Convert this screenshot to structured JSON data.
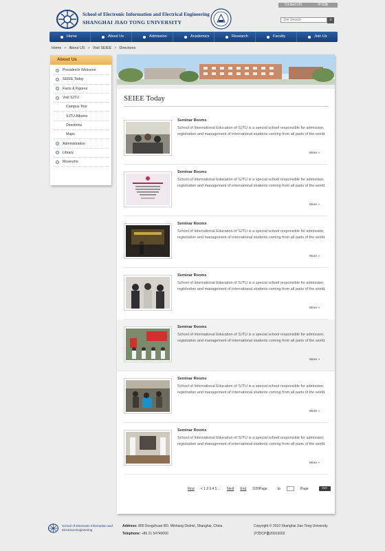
{
  "utility": {
    "contact": "Contact US",
    "chinese": "中文版"
  },
  "header": {
    "school_name": "School of Electronic Information and Electrical Engineering",
    "university_name": "SHANGHAI JIAO TONG UNIVERSITY",
    "search_placeholder": "Site Search"
  },
  "nav": [
    "Home",
    "About Us",
    "Admission",
    "Academics",
    "Research",
    "Faculty",
    "Join Us"
  ],
  "breadcrumb": {
    "home": "Home",
    "about": "About US",
    "visit": "Visit SEIEE",
    "current": "Directions",
    "separator": ">"
  },
  "sidebar": {
    "title": "About Us",
    "items": [
      {
        "label": "President's Welcome",
        "sub": false,
        "icon": "plus"
      },
      {
        "label": "SEIEE Today",
        "sub": false,
        "icon": "plus"
      },
      {
        "label": "Facts & Figures",
        "sub": false,
        "icon": "plus"
      },
      {
        "label": "Visit SJTU",
        "sub": false,
        "icon": "minus"
      },
      {
        "label": "Campus Tour",
        "sub": true,
        "icon": ""
      },
      {
        "label": "SJTU Albums",
        "sub": true,
        "icon": ""
      },
      {
        "label": "Directions",
        "sub": true,
        "icon": ""
      },
      {
        "label": "Maps",
        "sub": true,
        "icon": ""
      },
      {
        "label": "Administration",
        "sub": false,
        "icon": "plus"
      },
      {
        "label": "Library",
        "sub": false,
        "icon": "plus"
      },
      {
        "label": "Museums",
        "sub": false,
        "icon": "plus"
      }
    ]
  },
  "main": {
    "title": "SEIEE Today",
    "news": [
      {
        "title": "Seminar Rooms",
        "desc": "School of International Education of SJTU is a special school responsible for admission, registration and management of international students coming from all parts of the world.",
        "more": "More »"
      },
      {
        "title": "Seminar Rooms",
        "desc": "School of International Education of SJTU is a special school responsible for admission, registration and management of international students coming from all parts of the world.",
        "more": "More »"
      },
      {
        "title": "Seminar Rooms",
        "desc": "School of International Education of SJTU is a special school responsible for admission, registration and management of international students coming from all parts of the world.",
        "more": "More »"
      },
      {
        "title": "Seminar Rooms",
        "desc": "School of International Education of SJTU is a special school responsible for admission, registration and management of international students coming from all parts of the world.",
        "more": "More »"
      },
      {
        "title": "Seminar Rooms",
        "desc": "School of International Education of SJTU is a special school responsible for admission, registration and management of international students coming from all parts of the world.",
        "more": "More »"
      },
      {
        "title": "Seminar Rooms",
        "desc": "School of International Education of SJTU is a special school responsible for admission, registration and management of international students coming from all parts of the world.",
        "more": "More »"
      },
      {
        "title": "Seminar Rooms",
        "desc": "School of International Education of SJTU is a special school responsible for admission, registration and management of international students coming from all parts of the world.",
        "more": "More »"
      }
    ]
  },
  "pager": {
    "first": "First",
    "pages": "< 1 2 3 4 5 ...",
    "next": "Next",
    "end": "End",
    "info": "2/20Page",
    "to": "to",
    "page": "Page",
    "go": "GO"
  },
  "footer": {
    "name": "School of Electronic Information and Electrical Engineering",
    "address_label": "Address:",
    "address": "800 Dongchuan RD. Minhang District, Shanghai, China",
    "phone_label": "Telephone:",
    "phone": "+86 21 54740000",
    "copyright": "Copyright © 2010 Shanghai Jiao Tong University",
    "icp": "沪交ICP备20010002"
  }
}
